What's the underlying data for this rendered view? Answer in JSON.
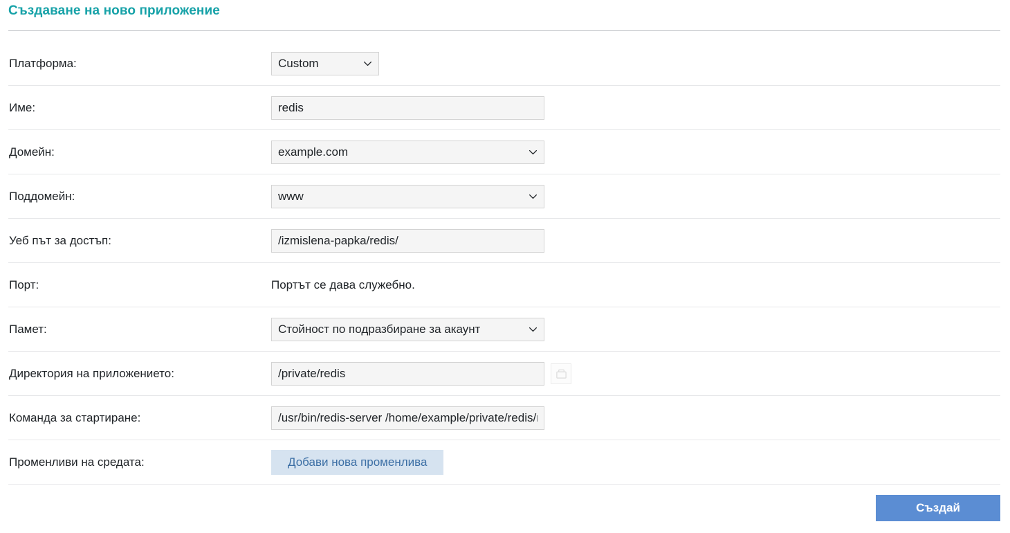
{
  "page": {
    "title": "Създаване на ново приложение"
  },
  "form": {
    "rows": [
      {
        "label": "Платформа:",
        "control": "select",
        "value": "Custom"
      },
      {
        "label": "Име:",
        "control": "input",
        "value": "redis"
      },
      {
        "label": "Домейн:",
        "control": "select",
        "value": "example.com"
      },
      {
        "label": "Поддомейн:",
        "control": "select",
        "value": "www"
      },
      {
        "label": "Уеб път за достъп:",
        "control": "input",
        "value": "/izmislena-papka/redis/"
      },
      {
        "label": "Порт:",
        "control": "static",
        "value": "Портът се дава служебно."
      },
      {
        "label": "Памет:",
        "control": "select",
        "value": "Стойност по подразбиране за акаунт"
      },
      {
        "label": "Директория на приложението:",
        "control": "input-folder",
        "value": "/private/redis"
      },
      {
        "label": "Команда за стартиране:",
        "control": "input",
        "value": "/usr/bin/redis-server /home/example/private/redis/redis.conf"
      },
      {
        "label": "Променливи на средата:",
        "control": "button",
        "value": "Добави нова променлива"
      }
    ]
  },
  "icons": {
    "chevron_down": "chevron-down-icon",
    "folder": "folder-icon"
  },
  "footer": {
    "create_label": "Създай"
  },
  "colors": {
    "title_teal": "#17a2a8",
    "primary_blue": "#5b8dd3",
    "add_button_bg": "#d6e3f0",
    "add_button_text": "#3c6fa5",
    "input_bg": "#f5f5f5",
    "input_border": "#d3d3d3",
    "divider": "#e6e7e9",
    "title_rule": "#b9bdc1"
  }
}
